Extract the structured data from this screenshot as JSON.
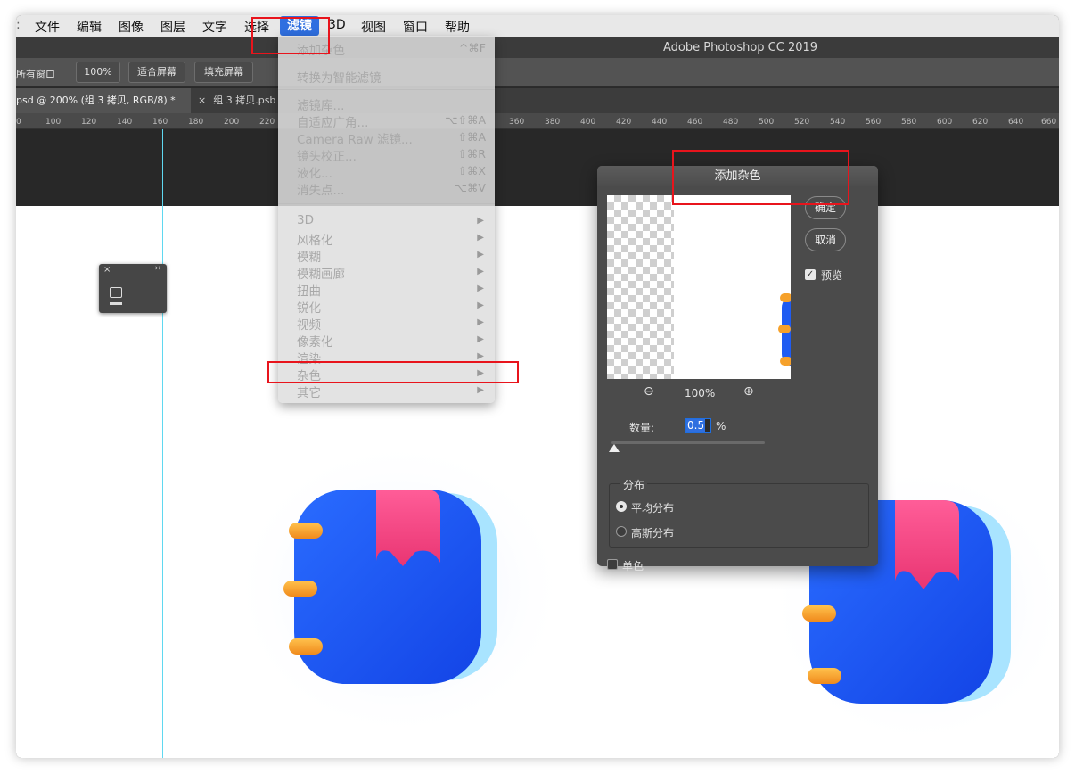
{
  "menubar": {
    "items": [
      "文件",
      "编辑",
      "图像",
      "图层",
      "文字",
      "选择",
      "滤镜",
      "3D",
      "视图",
      "窗口",
      "帮助"
    ],
    "active": "滤镜"
  },
  "app_title": "Adobe Photoshop CC 2019",
  "options_bar": {
    "left_label": "所有窗口",
    "zoom": "100%",
    "fit_screen": "适合屏幕",
    "fill_screen": "填充屏幕"
  },
  "tabs": [
    {
      "label": "psd @ 200% (组 3 拷贝, RGB/8) *"
    },
    {
      "label": "组 3 拷贝.psb"
    }
  ],
  "ruler_ticks": [
    "0",
    "100",
    "120",
    "140",
    "160",
    "180",
    "200",
    "220",
    "360",
    "380",
    "400",
    "420",
    "440",
    "460",
    "480",
    "500",
    "520",
    "540",
    "560",
    "580",
    "600",
    "620",
    "640",
    "660"
  ],
  "filter_menu": {
    "last_filter": {
      "label": "添加杂色",
      "shortcut": "^⌘F"
    },
    "smart": "转换为智能滤镜",
    "items_with_shortcuts": [
      {
        "label": "滤镜库...",
        "shortcut": ""
      },
      {
        "label": "自适应广角...",
        "shortcut": "⌥⇧⌘A"
      },
      {
        "label": "Camera Raw 滤镜...",
        "shortcut": "⇧⌘A"
      },
      {
        "label": "镜头校正...",
        "shortcut": "⇧⌘R"
      },
      {
        "label": "液化...",
        "shortcut": "⇧⌘X"
      },
      {
        "label": "消失点...",
        "shortcut": "⌥⌘V"
      }
    ],
    "submenus": [
      "3D",
      "风格化",
      "模糊",
      "模糊画廊",
      "扭曲",
      "锐化",
      "视频",
      "像素化",
      "渲染",
      "杂色",
      "其它"
    ],
    "highlighted": "杂色"
  },
  "dialog": {
    "title": "添加杂色",
    "ok": "确定",
    "cancel": "取消",
    "preview_label": "预览",
    "preview_checked": true,
    "zoom": "100%",
    "amount_label": "数量:",
    "amount_value": "0.5",
    "amount_unit": "%",
    "distribution_label": "分布",
    "uniform": "平均分布",
    "gaussian": "高斯分布",
    "distribution_selected": "平均分布",
    "monochrome": "单色",
    "monochrome_checked": false
  },
  "colors": {
    "menu_active": "#2f6fe0",
    "highlight": "#e8141c",
    "icon_blue": "#1f5cf2",
    "icon_pink": "#f0457f",
    "icon_orange": "#f6a12b"
  }
}
